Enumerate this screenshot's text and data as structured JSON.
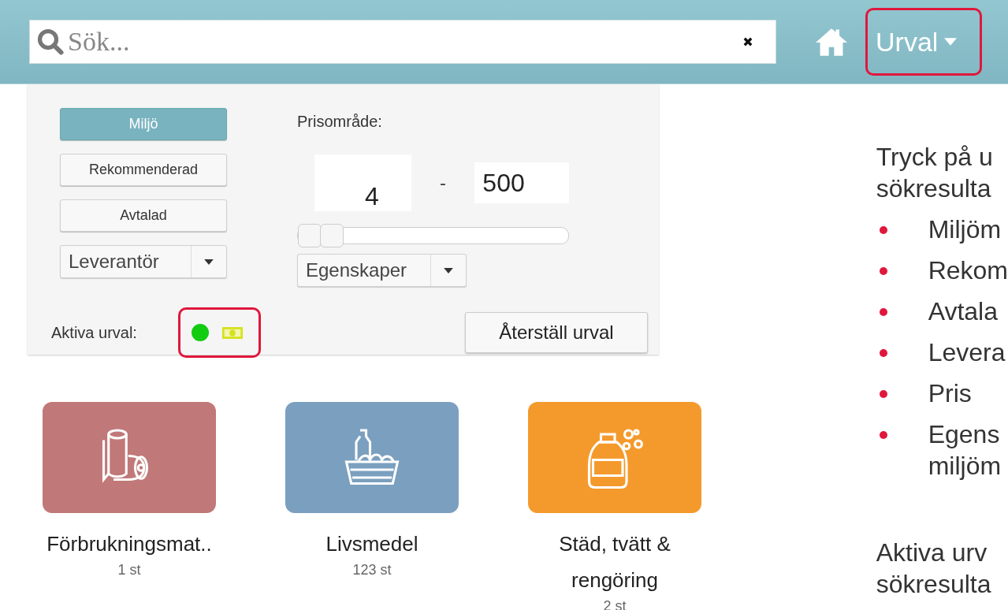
{
  "search": {
    "placeholder": "Sök..."
  },
  "urval_button": {
    "label": "Urval",
    "highlighted": true
  },
  "filter_panel": {
    "toggles": [
      {
        "label": "Miljö",
        "selected": true
      },
      {
        "label": "Rekommenderad",
        "selected": false
      },
      {
        "label": "Avtalad",
        "selected": false
      }
    ],
    "supplier_dropdown": {
      "label": "Leverantör"
    },
    "price_range": {
      "label": "Prisområde:",
      "min": "4",
      "separator": "-",
      "max": "500",
      "thumbs": [
        {
          "level": 0.0
        },
        {
          "level": 0.09
        }
      ]
    },
    "properties_dropdown": {
      "label": "Egenskaper"
    },
    "active_filters": {
      "label": "Aktiva urval:",
      "highlighted": true,
      "items": [
        {
          "kind": "dot",
          "color": "#11cc11"
        },
        {
          "kind": "money",
          "color": "#d6e11f"
        }
      ]
    },
    "reset_button": {
      "label": "Återställ urval"
    }
  },
  "categories": [
    {
      "kind": "paper",
      "name": "Förbrukningsmat..",
      "count": "1 st",
      "color": "#c07878"
    },
    {
      "kind": "food",
      "name": "Livsmedel",
      "count": "123 st",
      "color": "#7b9fbf"
    },
    {
      "kind": "cleaning",
      "name": "Städ, tvätt & rengöring",
      "count": "2 st",
      "color": "#f49a2c"
    }
  ],
  "instructions": {
    "intro": [
      "Tryck på u",
      "sökresulta"
    ],
    "bullets": [
      [
        "Miljöm"
      ],
      [
        "Rekom"
      ],
      [
        "Avtala"
      ],
      [
        "Levera"
      ],
      [
        "Pris"
      ],
      [
        "Egens",
        "miljöm"
      ]
    ],
    "outro": [
      "Aktiva urv",
      "sökresulta"
    ]
  }
}
